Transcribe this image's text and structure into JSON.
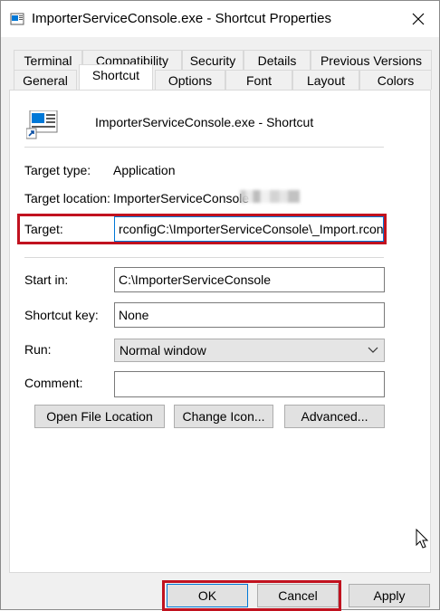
{
  "window": {
    "title": "ImporterServiceConsole.exe - Shortcut Properties"
  },
  "tabs": {
    "row1": [
      "Terminal",
      "Compatibility",
      "Security",
      "Details",
      "Previous Versions"
    ],
    "row2": [
      "General",
      "Shortcut",
      "Options",
      "Font",
      "Layout",
      "Colors"
    ],
    "active": "Shortcut"
  },
  "shortcut": {
    "name": "ImporterServiceConsole.exe - Shortcut",
    "target_type_label": "Target type:",
    "target_type_value": "Application",
    "target_location_label": "Target location:",
    "target_location_value": "ImporterServiceConsole",
    "target_label": "Target:",
    "target_value": "rconfigC:\\ImporterServiceConsole\\_Import.rconfig",
    "start_in_label": "Start in:",
    "start_in_value": "C:\\ImporterServiceConsole",
    "shortcut_key_label": "Shortcut key:",
    "shortcut_key_value": "None",
    "run_label": "Run:",
    "run_value": "Normal window",
    "comment_label": "Comment:",
    "comment_value": "",
    "open_file_location": "Open File Location",
    "change_icon": "Change Icon...",
    "advanced": "Advanced..."
  },
  "footer": {
    "ok": "OK",
    "cancel": "Cancel",
    "apply": "Apply"
  },
  "colors": {
    "highlight": "#c1121f",
    "icon_blue": "#0078d7"
  }
}
